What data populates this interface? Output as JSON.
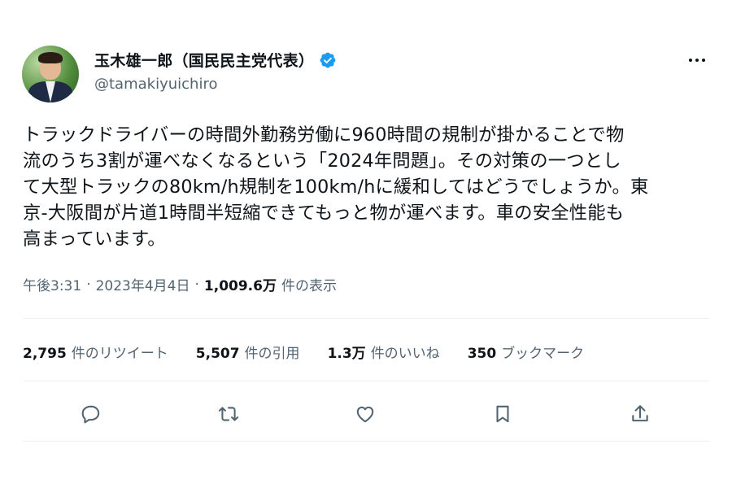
{
  "user": {
    "display_name": "玉木雄一郎（国民民主党代表）",
    "handle": "@tamakiyuichiro",
    "verified": true
  },
  "tweet": {
    "text": "トラックドライバーの時間外勤務労働に960時間の規制が掛かることで物\n流のうち3割が運べなくなるという「2024年問題」。その対策の一つとし\nて大型トラックの80km/h規制を100km/hに緩和してはどうでしょうか。東\n京-大阪間が片道1時間半短縮できてもっと物が運べます。車の安全性能も\n高まっています。"
  },
  "meta": {
    "time": "午後3:31",
    "date": "2023年4月4日",
    "separator": "·",
    "views": "1,009.6万",
    "views_label": "件の表示"
  },
  "stats": {
    "retweets": {
      "count": "2,795",
      "label": "件のリツイート"
    },
    "quotes": {
      "count": "5,507",
      "label": "件の引用"
    },
    "likes": {
      "count": "1.3万",
      "label": "件のいいね"
    },
    "bookmarks": {
      "count": "350",
      "label": "ブックマーク"
    }
  },
  "icons": {
    "verified": "verified-badge-icon",
    "more": "more-options-icon",
    "reply": "reply-icon",
    "retweet": "retweet-icon",
    "like": "like-icon",
    "bookmark": "bookmark-icon",
    "share": "share-icon"
  },
  "colors": {
    "verified": "#1d9bf0",
    "text": "#0f1419",
    "secondary": "#536471",
    "divider": "#eff3f4"
  }
}
